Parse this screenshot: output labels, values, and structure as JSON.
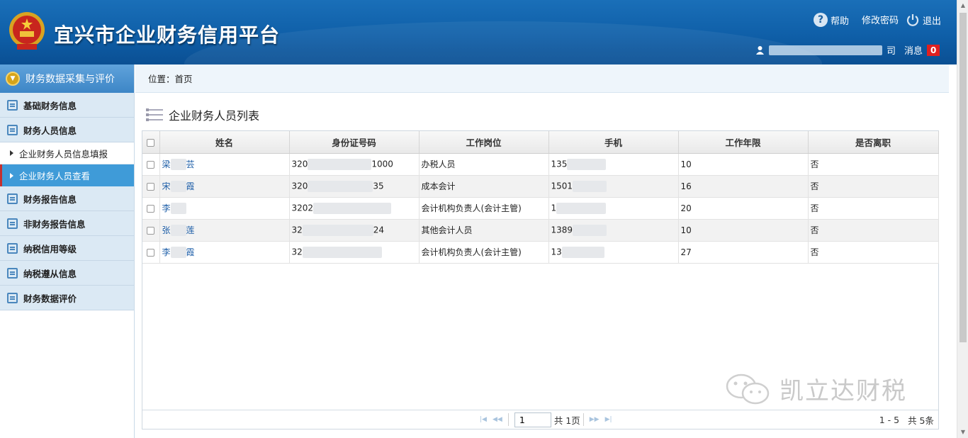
{
  "header": {
    "title": "宜兴市企业财务信用平台",
    "help_label": "帮助",
    "change_password_label": "修改密码",
    "logout_label": "退出",
    "messages_label": "消息",
    "message_count": "0",
    "user_suffix": "司",
    "colors": {
      "bg": "#0f5fa8",
      "badge": "#e02020"
    }
  },
  "sidebar": {
    "group_title": "财务数据采集与评价",
    "items": [
      {
        "label": "基础财务信息"
      },
      {
        "label": "财务人员信息"
      },
      {
        "label": "财务报告信息"
      },
      {
        "label": "非财务报告信息"
      },
      {
        "label": "纳税信用等级"
      },
      {
        "label": "纳税遵从信息"
      },
      {
        "label": "财务数据评价"
      }
    ],
    "subitems": [
      {
        "label": "企业财务人员信息填报"
      },
      {
        "label": "企业财务人员查看",
        "active": true
      }
    ]
  },
  "breadcrumb": {
    "text": "位置：首页"
  },
  "section": {
    "title": "企业财务人员列表"
  },
  "table": {
    "columns": [
      "姓名",
      "身份证号码",
      "工作岗位",
      "手机",
      "工作年限",
      "是否离职"
    ],
    "rows": [
      {
        "name": "梁",
        "name_tail": "芸",
        "id_prefix": "320",
        "id_suffix": "1000",
        "position": "办税人员",
        "phone_prefix": "135",
        "years": "10",
        "resigned": "否"
      },
      {
        "name": "宋",
        "name_tail": "霞",
        "id_prefix": "320",
        "id_suffix": "35",
        "position": "成本会计",
        "phone_prefix": "1501",
        "years": "16",
        "resigned": "否"
      },
      {
        "name": "李",
        "name_tail": "",
        "id_prefix": "3202",
        "id_suffix": "",
        "position": "会计机构负责人(会计主管)",
        "phone_prefix": "1",
        "years": "20",
        "resigned": "否"
      },
      {
        "name": "张",
        "name_tail": "莲",
        "id_prefix": "32",
        "id_suffix": "24",
        "position": "其他会计人员",
        "phone_prefix": "1389",
        "years": "10",
        "resigned": "否"
      },
      {
        "name": "李",
        "name_tail": "霞",
        "id_prefix": "32",
        "id_suffix": "",
        "position": "会计机构负责人(会计主管)",
        "phone_prefix": "13",
        "years": "27",
        "resigned": "否"
      }
    ]
  },
  "pager": {
    "current_page": "1",
    "total_pages_text": "共 1页",
    "range_text": "1 - 5",
    "total_text": "共 5条"
  },
  "watermark": {
    "text": "凯立达财税"
  },
  "icons": [
    "emblem-icon",
    "help-icon",
    "power-icon",
    "user-icon",
    "chevron-down-icon",
    "list-icon",
    "wechat-icon"
  ]
}
